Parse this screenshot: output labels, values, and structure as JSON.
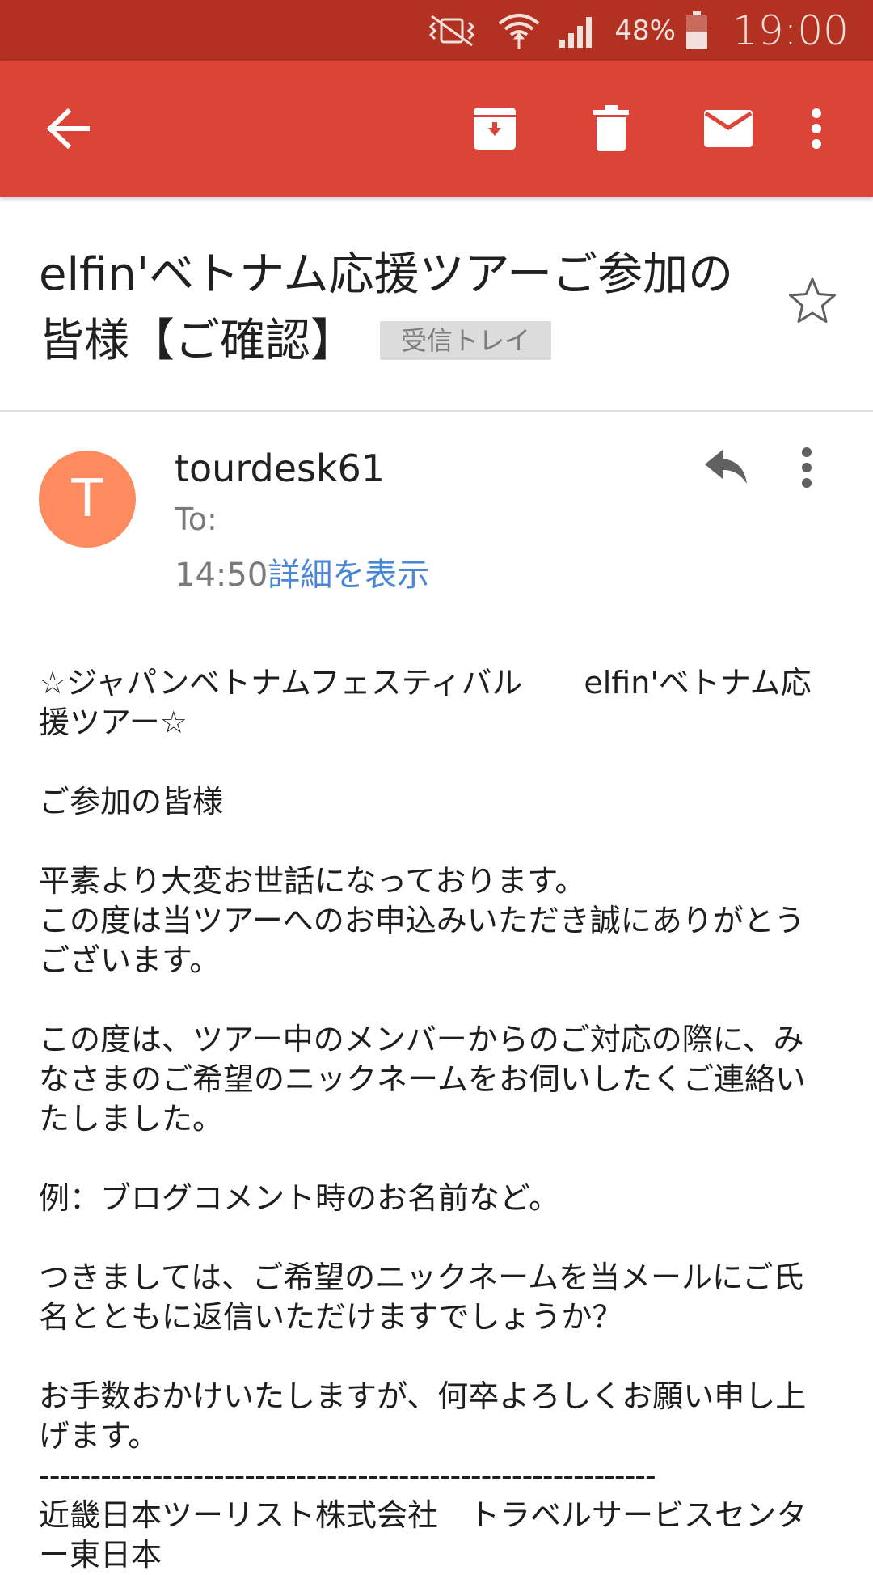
{
  "status_bar": {
    "battery": "48%",
    "time": "19:00",
    "icons": [
      "vibrate-mute-icon",
      "wifi-icon",
      "signal-icon",
      "battery-icon"
    ]
  },
  "app_bar": {
    "icons": [
      "back-arrow-icon",
      "archive-icon",
      "delete-icon",
      "mark-unread-icon",
      "more-vert-icon"
    ]
  },
  "email": {
    "subject_line1": "elfin'ベトナム応援ツアーご参加の",
    "subject_line2": "皆様【ご確認】",
    "label": "受信トレイ",
    "avatar_letter": "T",
    "sender": "tourdesk61",
    "to": "To:",
    "time": "14:50",
    "details_link": "詳細を表示",
    "body": {
      "p1_l1": "☆ジャパンベトナムフェスティバル　　elfin'ベトナム応",
      "p1_l2": "援ツアー☆",
      "p2": "ご参加の皆様",
      "p3_l1": "平素より大変お世話になっております。",
      "p3_l2": "この度は当ツアーへのお申込みいただき誠にありがとう",
      "p3_l3": "ございます。",
      "p4_l1": "この度は、ツアー中のメンバーからのご対応の際に、み",
      "p4_l2": "なさまのご希望のニックネームをお伺いしたくご連絡い",
      "p4_l3": "たしました。",
      "p5": "例：ブログコメント時のお名前など。",
      "p6_l1": "つきましては、ご希望のニックネームを当メールにご氏",
      "p6_l2": "名とともに返信いただけますでしょうか？",
      "p7_l1": "お手数おかけいたしますが、何卒よろしくお願い申し上",
      "p7_l2": "げます。",
      "divider": "------------------------------------------------------------",
      "sig_l1": "近畿日本ツーリスト株式会社　トラベルサービスセンタ",
      "sig_l2": "ー東日本"
    }
  },
  "colors": {
    "status_bar": "#b23121",
    "app_bar": "#db4437",
    "avatar": "#fe8a5f",
    "link": "#4a86d6"
  }
}
